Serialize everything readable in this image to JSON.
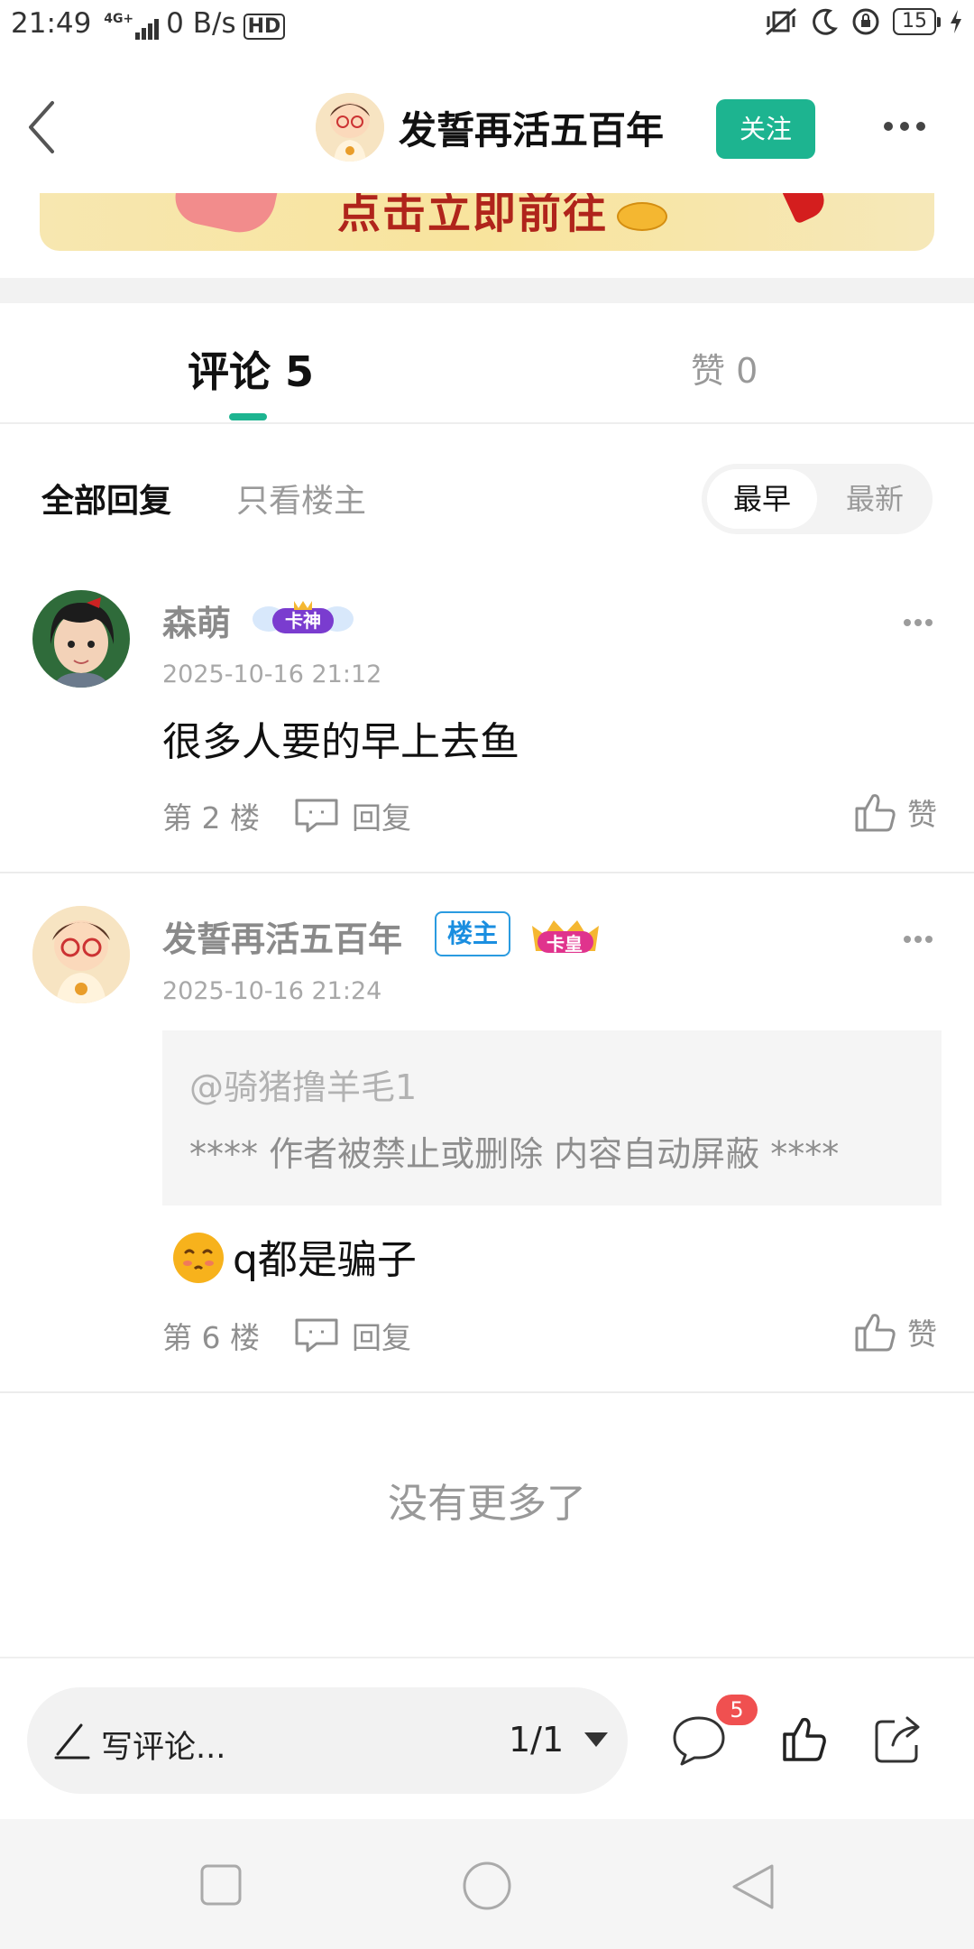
{
  "status_bar": {
    "time": "21:49",
    "network": "4G+",
    "speed": "0 B/s",
    "hd": "HD",
    "battery": "15"
  },
  "header": {
    "title": "发誓再活五百年",
    "follow_label": "关注"
  },
  "banner": {
    "text": "点击立即前往"
  },
  "tabs": {
    "comments_label": "评论 5",
    "likes_label": "赞 0"
  },
  "filters": {
    "all": "全部回复",
    "op_only": "只看楼主",
    "sort_earliest": "最早",
    "sort_newest": "最新"
  },
  "comments": [
    {
      "user": "森萌",
      "badge": "卡神",
      "date": "2025-10-16 21:12",
      "text": "很多人要的早上去鱼",
      "floor": "第 2 楼",
      "reply_label": "回复",
      "like_label": "赞"
    },
    {
      "user": "发誓再活五百年",
      "host_tag": "楼主",
      "badge": "卡皇",
      "date": "2025-10-16 21:24",
      "quote_at": "@骑猪撸羊毛1",
      "quote_body": "**** 作者被禁止或删除 内容自动屏蔽 ****",
      "text": "q都是骗子",
      "floor": "第 6 楼",
      "reply_label": "回复",
      "like_label": "赞"
    }
  ],
  "footer": {
    "no_more": "没有更多了"
  },
  "bottom_bar": {
    "write_placeholder": "写评论...",
    "page": "1/1",
    "comment_count": "5"
  },
  "colors": {
    "accent": "#1db490",
    "badge_red": "#f05050",
    "host_blue": "#1a8ee0"
  }
}
